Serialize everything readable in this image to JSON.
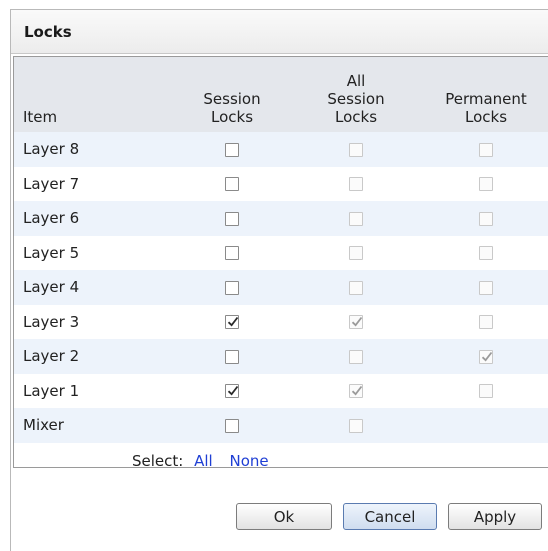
{
  "dialog": {
    "title": "Locks",
    "close_label": "×"
  },
  "columns": {
    "item": [
      "Item"
    ],
    "session": [
      "Session",
      "Locks"
    ],
    "all_session": [
      "All",
      "Session",
      "Locks"
    ],
    "permanent": [
      "Permanent",
      "Locks"
    ]
  },
  "rows": [
    {
      "name": "Layer 8",
      "session": false,
      "all_session": false,
      "permanent": false
    },
    {
      "name": "Layer 7",
      "session": false,
      "all_session": false,
      "permanent": false
    },
    {
      "name": "Layer 6",
      "session": false,
      "all_session": false,
      "permanent": false
    },
    {
      "name": "Layer 5",
      "session": false,
      "all_session": false,
      "permanent": false
    },
    {
      "name": "Layer 4",
      "session": false,
      "all_session": false,
      "permanent": false
    },
    {
      "name": "Layer 3",
      "session": true,
      "all_session": true,
      "permanent": false
    },
    {
      "name": "Layer 2",
      "session": false,
      "all_session": false,
      "permanent": true
    },
    {
      "name": "Layer 1",
      "session": true,
      "all_session": true,
      "permanent": false
    },
    {
      "name": "Mixer",
      "session": false,
      "all_session": false,
      "permanent": null
    }
  ],
  "select": {
    "label": "Select:",
    "all": "All",
    "none": "None"
  },
  "buttons": {
    "ok": "Ok",
    "cancel": "Cancel",
    "apply": "Apply"
  },
  "icons": {
    "checkbox": "checkbox-icon",
    "checkmark": "checkmark-icon"
  },
  "colors": {
    "header_bg": "#e4e7ec",
    "alt_row_bg": "#edf3fb",
    "link": "#1f3fd4"
  }
}
